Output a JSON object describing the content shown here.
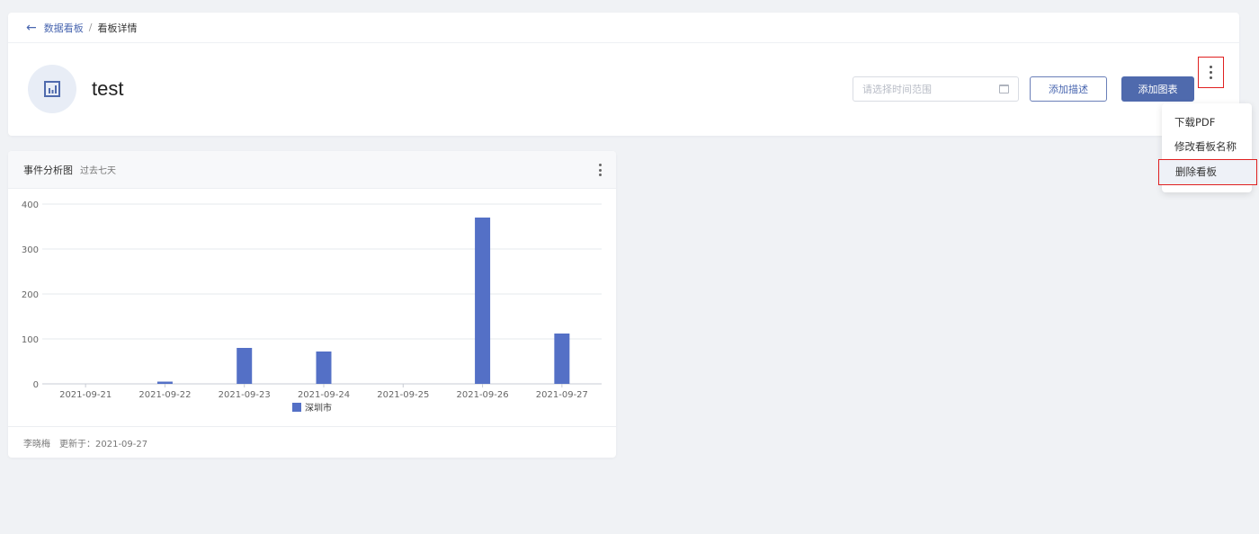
{
  "breadcrumb": {
    "parent": "数据看板",
    "separator": "/",
    "current": "看板详情"
  },
  "page": {
    "title": "test"
  },
  "toolbar": {
    "date_placeholder": "请选择时间范围",
    "add_desc_label": "添加描述",
    "add_chart_label": "添加图表"
  },
  "menu": {
    "items": [
      "下载PDF",
      "修改看板名称",
      "删除看板"
    ]
  },
  "chart_card": {
    "title": "事件分析图",
    "subtitle": "过去七天",
    "footer_user": "李晓梅",
    "footer_updated": "更新于：2021-09-27"
  },
  "colors": {
    "accent": "#4f6aad",
    "bar": "#5470c6",
    "highlight_border": "#e02020"
  },
  "chart_data": {
    "type": "bar",
    "categories": [
      "2021-09-21",
      "2021-09-22",
      "2021-09-23",
      "2021-09-24",
      "2021-09-25",
      "2021-09-26",
      "2021-09-27"
    ],
    "series": [
      {
        "name": "深圳市",
        "values": [
          0,
          5,
          80,
          72,
          0,
          370,
          112
        ]
      }
    ],
    "y_ticks": [
      0,
      100,
      200,
      300,
      400
    ],
    "ylim": [
      0,
      400
    ],
    "grid": true,
    "legend_position": "bottom-center"
  }
}
